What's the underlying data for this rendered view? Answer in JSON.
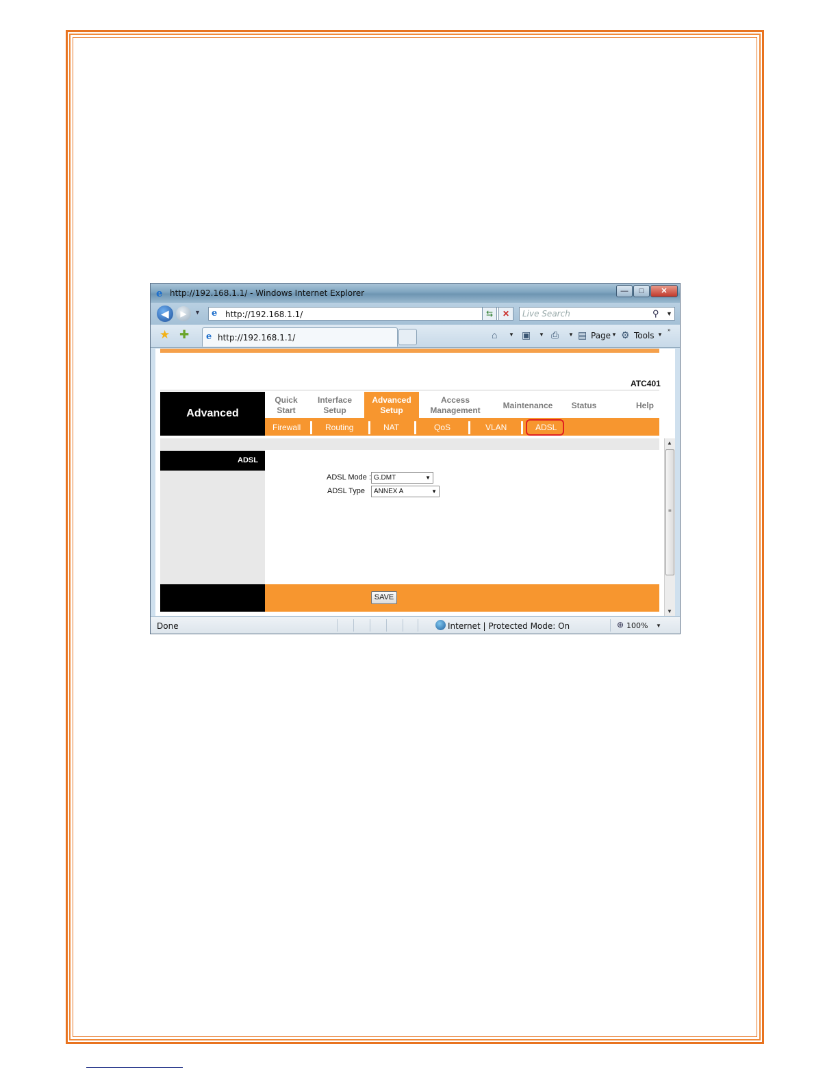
{
  "browser": {
    "title": "http://192.168.1.1/ - Windows Internet Explorer",
    "address": "http://192.168.1.1/",
    "search_placeholder": "Live Search",
    "tab_title": "http://192.168.1.1/",
    "commands": {
      "page": "Page",
      "tools": "Tools"
    },
    "status": {
      "done": "Done",
      "zone": "Internet | Protected Mode: On",
      "zoom": "100%"
    }
  },
  "router": {
    "model": "ATC401",
    "section": "Advanced",
    "menu": [
      {
        "line1": "Quick",
        "line2": "Start"
      },
      {
        "line1": "Interface",
        "line2": "Setup"
      },
      {
        "line1": "Advanced",
        "line2": "Setup"
      },
      {
        "line1": "Access",
        "line2": "Management"
      },
      {
        "line1": "Maintenance",
        "line2": ""
      },
      {
        "line1": "Status",
        "line2": ""
      },
      {
        "line1": "Help",
        "line2": ""
      }
    ],
    "submenu": [
      "Firewall",
      "Routing",
      "NAT",
      "QoS",
      "VLAN",
      "ADSL"
    ],
    "side_title": "ADSL",
    "form": {
      "mode_label": "ADSL Mode :",
      "mode_value": "G.DMT",
      "type_label": "ADSL Type",
      "type_value": "ANNEX A"
    },
    "save_label": "SAVE"
  }
}
